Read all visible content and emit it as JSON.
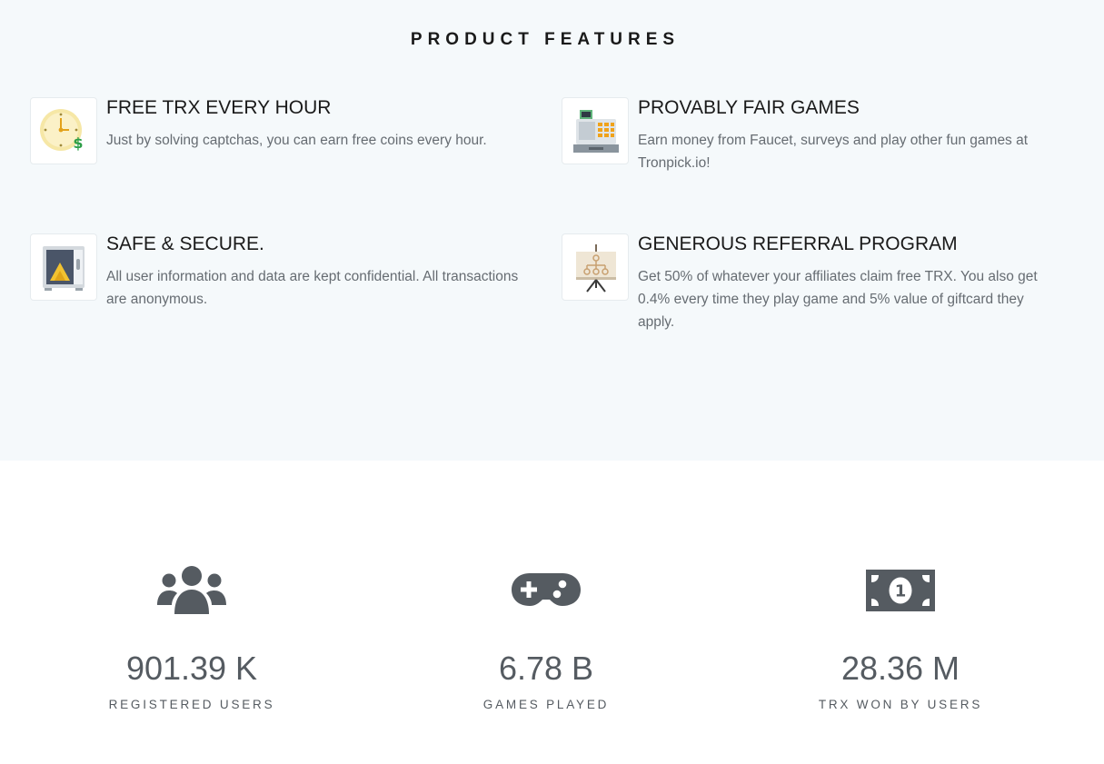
{
  "features": {
    "title": "PRODUCT FEATURES",
    "items": [
      {
        "title": "FREE TRX EVERY HOUR",
        "text": "Just by solving captchas, you can earn free coins every hour.",
        "icon": "clock-money-icon"
      },
      {
        "title": "PROVABLY FAIR GAMES",
        "text": "Earn money from Faucet, surveys and play other fun games at Tronpick.io!",
        "icon": "cash-register-icon"
      },
      {
        "title": "SAFE & SECURE.",
        "text": "All user information and data are kept confidential. All transactions are anonymous.",
        "icon": "safe-icon"
      },
      {
        "title": "GENEROUS REFERRAL PROGRAM",
        "text": "Get 50% of whatever your affiliates claim free TRX. You also get 0.4% every time they play game and 5% value of giftcard they apply.",
        "icon": "presentation-board-icon"
      }
    ]
  },
  "stats": [
    {
      "value": "901.39 K",
      "label": "REGISTERED USERS",
      "icon": "users-icon"
    },
    {
      "value": "6.78 B",
      "label": "GAMES PLAYED",
      "icon": "gamepad-icon"
    },
    {
      "value": "28.36 M",
      "label": "TRX WON BY USERS",
      "icon": "banknote-icon"
    }
  ],
  "colors": {
    "features_bg": "#f5f9fb",
    "stat_icon": "#555b61"
  }
}
